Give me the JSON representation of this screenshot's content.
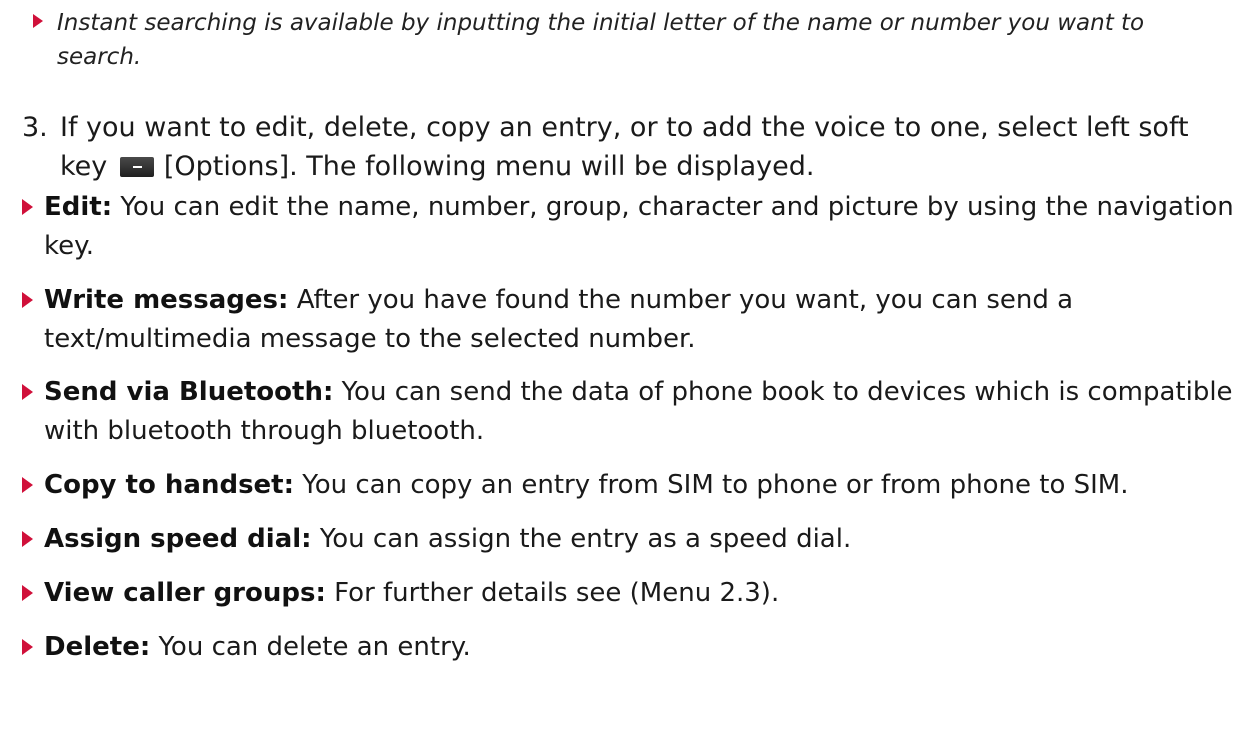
{
  "tip": {
    "text": "Instant searching is available by inputting the initial letter of the name or number you want to search."
  },
  "step": {
    "number": "3.",
    "text_before": "If you want to edit, delete, copy an entry, or to add the voice to one, select left soft key",
    "key_label": "[Options]",
    "text_after": ". The following menu will be displayed."
  },
  "items": [
    {
      "term": "Edit:",
      "desc": "You can edit the name, number, group, character and picture by using the navigation key."
    },
    {
      "term": "Write messages:",
      "desc": "After you have found the number you want, you can send a text/multimedia message to the selected number."
    },
    {
      "term": "Send via Bluetooth:",
      "desc": "You can send the data of phone book to devices which is compatible with bluetooth through bluetooth."
    },
    {
      "term": "Copy to handset:",
      "desc": "You can copy an entry from SIM to phone or from phone to SIM."
    },
    {
      "term": "Assign speed dial:",
      "desc": "You can assign the entry as a speed dial."
    },
    {
      "term": "View caller groups:",
      "desc": "For further details see (Menu 2.3)."
    },
    {
      "term": "Delete:",
      "desc": "You can delete an entry."
    }
  ],
  "icons": {
    "bullet": "red-triangle-bullet-icon",
    "softkey": "left-soft-key-icon"
  },
  "colors": {
    "bullet": "#d0103a",
    "text": "#1a1a1a"
  }
}
